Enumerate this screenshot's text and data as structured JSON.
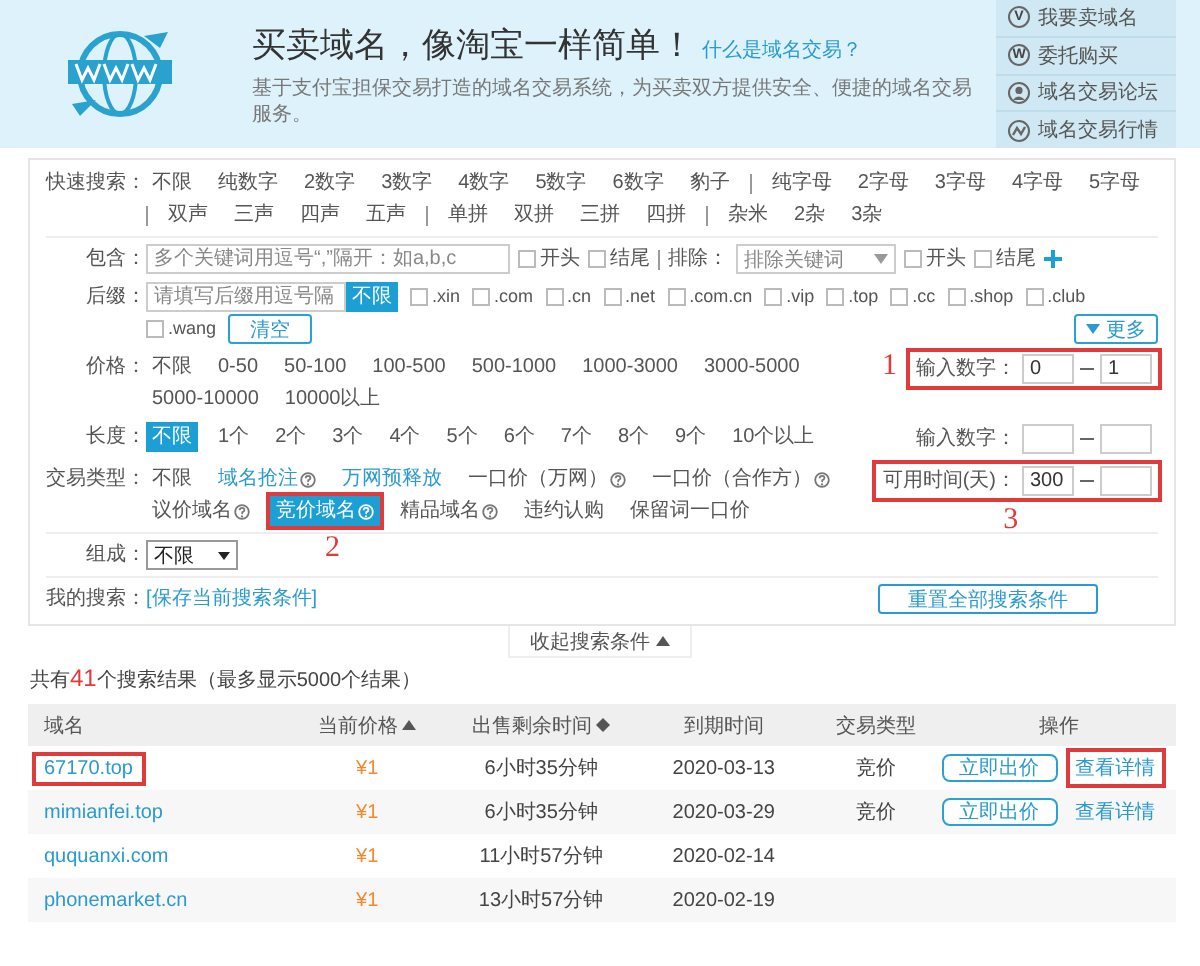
{
  "header": {
    "title": "买卖域名，像淘宝一样简单！",
    "help_link": "什么是域名交易？",
    "subtitle": "基于支付宝担保交易打造的域名交易系统，为买卖双方提供安全、便捷的域名交易服务。"
  },
  "side_links": [
    {
      "label": "我要卖域名",
      "kind": "letter",
      "letter": "V"
    },
    {
      "label": "委托购买",
      "kind": "letter",
      "letter": "W"
    },
    {
      "label": "域名交易论坛",
      "kind": "person"
    },
    {
      "label": "域名交易行情",
      "kind": "trend"
    }
  ],
  "filters": {
    "quick_search": {
      "label": "快速搜索：",
      "groups": [
        [
          {
            "label": "不限",
            "selected": false
          },
          {
            "label": "纯数字",
            "selected": false
          },
          {
            "label": "2数字",
            "selected": false
          },
          {
            "label": "3数字",
            "selected": false
          },
          {
            "label": "4数字",
            "selected": false
          },
          {
            "label": "5数字",
            "selected": false
          },
          {
            "label": "6数字",
            "selected": false
          },
          {
            "label": "豹子",
            "selected": false
          }
        ],
        [
          {
            "label": "纯字母",
            "selected": false
          },
          {
            "label": "2字母",
            "selected": false
          },
          {
            "label": "3字母",
            "selected": false
          },
          {
            "label": "4字母",
            "selected": false
          },
          {
            "label": "5字母",
            "selected": false
          }
        ],
        [
          {
            "label": "双声",
            "selected": false
          },
          {
            "label": "三声",
            "selected": false
          },
          {
            "label": "四声",
            "selected": false
          },
          {
            "label": "五声",
            "selected": false
          }
        ],
        [
          {
            "label": "单拼",
            "selected": false
          },
          {
            "label": "双拼",
            "selected": false
          },
          {
            "label": "三拼",
            "selected": false
          },
          {
            "label": "四拼",
            "selected": false
          }
        ],
        [
          {
            "label": "杂米",
            "selected": false
          },
          {
            "label": "2杂",
            "selected": false
          },
          {
            "label": "3杂",
            "selected": false
          }
        ]
      ]
    },
    "contain": {
      "label": "包含：",
      "placeholder": "多个关键词用逗号“,”隔开：如a,b,c",
      "options": [
        {
          "label": "开头",
          "checked": false
        },
        {
          "label": "结尾",
          "checked": false
        }
      ]
    },
    "exclude": {
      "label": "排除：",
      "placeholder": "排除关键词",
      "options": [
        {
          "label": "开头",
          "checked": false
        },
        {
          "label": "结尾",
          "checked": false
        }
      ]
    },
    "suffix": {
      "label": "后缀：",
      "placeholder": "请填写后缀用逗号隔",
      "any": {
        "label": "不限",
        "selected": true
      },
      "options": [
        {
          "label": ".xin",
          "checked": false
        },
        {
          "label": ".com",
          "checked": false
        },
        {
          "label": ".cn",
          "checked": false
        },
        {
          "label": ".net",
          "checked": false
        },
        {
          "label": ".com.cn",
          "checked": false
        },
        {
          "label": ".vip",
          "checked": false
        },
        {
          "label": ".top",
          "checked": false
        },
        {
          "label": ".cc",
          "checked": false
        },
        {
          "label": ".shop",
          "checked": false
        },
        {
          "label": ".club",
          "checked": false
        },
        {
          "label": ".wang",
          "checked": false
        }
      ],
      "clear": "清空",
      "more": "更多"
    },
    "price": {
      "label": "价格：",
      "options": [
        {
          "label": "不限",
          "selected": false
        },
        {
          "label": "0-50",
          "selected": false
        },
        {
          "label": "50-100",
          "selected": false
        },
        {
          "label": "100-500",
          "selected": false
        },
        {
          "label": "500-1000",
          "selected": false
        },
        {
          "label": "1000-3000",
          "selected": false
        },
        {
          "label": "3000-5000",
          "selected": false
        },
        {
          "label": "5000-10000",
          "selected": false
        },
        {
          "label": "10000以上",
          "selected": false
        }
      ],
      "custom": {
        "label": "输入数字：",
        "min": "0",
        "max": "1",
        "marked": true,
        "annotation": "1"
      }
    },
    "length": {
      "label": "长度：",
      "options": [
        {
          "label": "不限",
          "selected": true
        },
        {
          "label": "1个",
          "selected": false
        },
        {
          "label": "2个",
          "selected": false
        },
        {
          "label": "3个",
          "selected": false
        },
        {
          "label": "4个",
          "selected": false
        },
        {
          "label": "5个",
          "selected": false
        },
        {
          "label": "6个",
          "selected": false
        },
        {
          "label": "7个",
          "selected": false
        },
        {
          "label": "8个",
          "selected": false
        },
        {
          "label": "9个",
          "selected": false
        },
        {
          "label": "10个以上",
          "selected": false
        }
      ],
      "custom": {
        "label": "输入数字："
      }
    },
    "trade_type": {
      "label": "交易类型：",
      "options": [
        {
          "label": "不限",
          "selected": false,
          "kind": "plain",
          "help": false
        },
        {
          "label": "域名抢注",
          "selected": false,
          "kind": "link",
          "help": true
        },
        {
          "label": "万网预释放",
          "selected": false,
          "kind": "link",
          "help": false
        },
        {
          "label": "一口价（万网）",
          "selected": false,
          "kind": "plain",
          "help": true
        },
        {
          "label": "一口价（合作方）",
          "selected": false,
          "kind": "plain",
          "help": true
        },
        {
          "label": "议价域名",
          "selected": false,
          "kind": "plain",
          "help": true
        },
        {
          "label": "竞价域名",
          "selected": true,
          "kind": "plain",
          "help": true,
          "marked": true,
          "annotation": "2"
        },
        {
          "label": "精品域名",
          "selected": false,
          "kind": "plain",
          "help": true
        },
        {
          "label": "违约认购",
          "selected": false,
          "kind": "plain",
          "help": false
        },
        {
          "label": "保留词一口价",
          "selected": false,
          "kind": "plain",
          "help": false
        }
      ],
      "custom": {
        "label": "可用时间(天)：",
        "min": "300",
        "marked": true,
        "annotation": "3"
      }
    },
    "composition": {
      "label": "组成：",
      "value": "不限"
    },
    "my_search": {
      "label": "我的搜索：",
      "link": "[保存当前搜索条件]",
      "reset": "重置全部搜索条件"
    }
  },
  "collapse": "收起搜索条件",
  "results": {
    "summary_prefix": "共有",
    "count": "41",
    "summary_suffix": "个搜索结果（最多显示5000个结果）",
    "columns": [
      {
        "label": "域名",
        "sortable": false,
        "sorted": false
      },
      {
        "label": "当前价格",
        "sortable": true,
        "sorted": true
      },
      {
        "label": "出售剩余时间",
        "sortable": true,
        "sorted": false
      },
      {
        "label": "到期时间",
        "sortable": false,
        "sorted": false
      },
      {
        "label": "交易类型",
        "sortable": false,
        "sorted": false
      },
      {
        "label": "操作",
        "sortable": false,
        "sorted": false
      }
    ],
    "rows": [
      {
        "domain": "67170.top",
        "domain_marked": true,
        "price": "¥1",
        "remaining": "6小时35分钟",
        "expiry": "2020-03-13",
        "type": "竞价",
        "actions": [
          {
            "label": "立即出价",
            "kind": "button",
            "marked": false
          },
          {
            "label": "查看详情",
            "kind": "link",
            "marked": true
          }
        ]
      },
      {
        "domain": "mimianfei.top",
        "domain_marked": false,
        "price": "¥1",
        "remaining": "6小时35分钟",
        "expiry": "2020-03-29",
        "type": "竞价",
        "actions": [
          {
            "label": "立即出价",
            "kind": "button",
            "marked": false
          },
          {
            "label": "查看详情",
            "kind": "link",
            "marked": false
          }
        ]
      },
      {
        "domain": "ququanxi.com",
        "domain_marked": false,
        "price": "¥1",
        "remaining": "11小时57分钟",
        "expiry": "2020-02-14"
      },
      {
        "domain": "phonemarket.cn",
        "domain_marked": false,
        "price": "¥1",
        "remaining": "13小时57分钟",
        "expiry": "2020-02-19"
      }
    ]
  }
}
